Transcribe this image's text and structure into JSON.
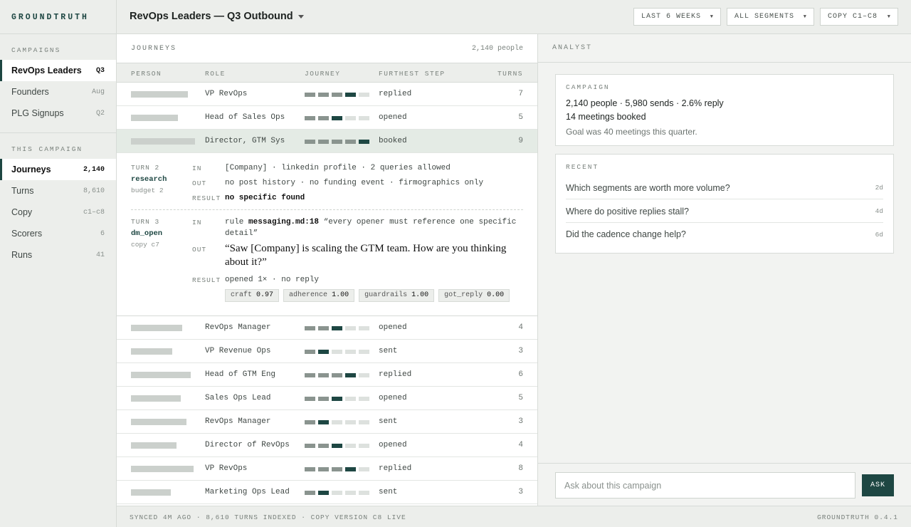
{
  "brand": "GROUNDTRUTH",
  "sidebar": {
    "campaigns_heading": "CAMPAIGNS",
    "campaigns": [
      {
        "label": "RevOps Leaders",
        "count": "Q3"
      },
      {
        "label": "Founders",
        "count": "Aug"
      },
      {
        "label": "PLG Signups",
        "count": "Q2"
      }
    ],
    "this_campaign_heading": "THIS CAMPAIGN",
    "sections": [
      {
        "label": "Journeys",
        "count": "2,140"
      },
      {
        "label": "Turns",
        "count": "8,610"
      },
      {
        "label": "Copy",
        "count": "c1–c8"
      },
      {
        "label": "Scorers",
        "count": "6"
      },
      {
        "label": "Runs",
        "count": "41"
      }
    ]
  },
  "header": {
    "title": "RevOps Leaders — Q3 Outbound",
    "filters": {
      "range": "LAST 6 WEEKS",
      "segment": "ALL SEGMENTS",
      "copy": "COPY C1–C8"
    }
  },
  "journeys": {
    "title": "JOURNEYS",
    "count": "2,140 people",
    "columns": {
      "person": "PERSON",
      "role": "ROLE",
      "journey": "JOURNEY",
      "step": "FURTHEST STEP",
      "turns": "TURNS"
    },
    "rows_top": [
      {
        "role": "VP RevOps",
        "journey": [
          1,
          1,
          1,
          2,
          0
        ],
        "step": "replied",
        "turns": "7"
      },
      {
        "role": "Head of Sales Ops",
        "journey": [
          1,
          1,
          2,
          0,
          0
        ],
        "step": "opened",
        "turns": "5"
      },
      {
        "role": "Director, GTM Sys",
        "journey": [
          1,
          1,
          1,
          1,
          2
        ],
        "step": "booked",
        "turns": "9"
      }
    ],
    "detail": {
      "turn2": {
        "label": "TURN 2",
        "name": "research",
        "sub": "budget 2",
        "in_label": "IN",
        "in": "[Company]  ·  linkedin profile  ·  2 queries allowed",
        "out_label": "OUT",
        "out": "no post history  ·  no funding event  ·  firmographics only",
        "result_label": "RESULT",
        "result": "no specific found"
      },
      "turn3": {
        "label": "TURN 3",
        "name": "dm_open",
        "sub": "copy c7",
        "in_label": "IN",
        "in_prefix": "rule",
        "in_rule": "messaging.md:18",
        "in_line1": "“every opener must reference one specific",
        "in_line2": "detail”",
        "out_label": "OUT",
        "quote": "“Saw [Company] is scaling the GTM team. How are you thinking about it?”",
        "result_label": "RESULT",
        "result": "opened 1×  ·  no reply",
        "scores": [
          {
            "name": "craft",
            "value": "0.97"
          },
          {
            "name": "adherence",
            "value": "1.00"
          },
          {
            "name": "guardrails",
            "value": "1.00"
          },
          {
            "name": "got_reply",
            "value": "0.00"
          }
        ]
      }
    },
    "rows_bottom": [
      {
        "role": "RevOps Manager",
        "journey": [
          1,
          1,
          2,
          0,
          0
        ],
        "step": "opened",
        "turns": "4"
      },
      {
        "role": "VP Revenue Ops",
        "journey": [
          1,
          2,
          0,
          0,
          0
        ],
        "step": "sent",
        "turns": "3"
      },
      {
        "role": "Head of GTM Eng",
        "journey": [
          1,
          1,
          1,
          2,
          0
        ],
        "step": "replied",
        "turns": "6"
      },
      {
        "role": "Sales Ops Lead",
        "journey": [
          1,
          1,
          2,
          0,
          0
        ],
        "step": "opened",
        "turns": "5"
      },
      {
        "role": "RevOps Manager",
        "journey": [
          1,
          2,
          0,
          0,
          0
        ],
        "step": "sent",
        "turns": "3"
      },
      {
        "role": "Director of RevOps",
        "journey": [
          1,
          1,
          2,
          0,
          0
        ],
        "step": "opened",
        "turns": "4"
      },
      {
        "role": "VP RevOps",
        "journey": [
          1,
          1,
          1,
          2,
          0
        ],
        "step": "replied",
        "turns": "8"
      },
      {
        "role": "Marketing Ops Lead",
        "journey": [
          1,
          2,
          0,
          0,
          0
        ],
        "step": "sent",
        "turns": "3"
      }
    ]
  },
  "analyst": {
    "title": "ANALYST",
    "campaign_card": {
      "heading": "CAMPAIGN",
      "stats_line": "2,140 people  ·  5,980 sends  ·  2.6% reply",
      "meetings": "14 meetings booked",
      "goal": "Goal was 40 meetings this quarter."
    },
    "recent_card": {
      "heading": "RECENT",
      "items": [
        {
          "q": "Which segments are worth more volume?",
          "age": "2d"
        },
        {
          "q": "Where do positive replies stall?",
          "age": "4d"
        },
        {
          "q": "Did the cadence change help?",
          "age": "6d"
        }
      ]
    },
    "ask_placeholder": "Ask about this campaign",
    "ask_button": "ASK"
  },
  "status": {
    "left": "SYNCED 4M AGO  ·  8,610 TURNS INDEXED  ·  COPY VERSION C8 LIVE",
    "right": "GROUNDTRUTH 0.4.1"
  },
  "colors": {
    "accent": "#1e4743",
    "selected_row": "#e4ebe5",
    "surface": "#f2f3f1"
  },
  "icons": {
    "title_caret": "caret-down-icon",
    "filter_arrow": "triangle-down-icon"
  }
}
